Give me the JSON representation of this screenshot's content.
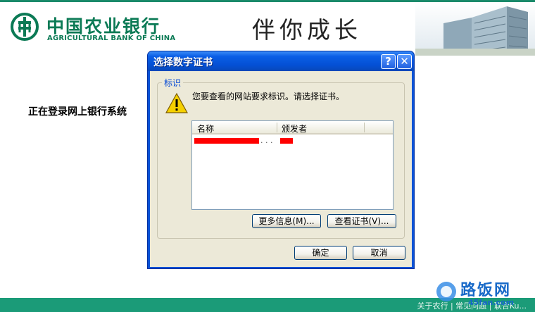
{
  "header": {
    "bank_name_cn": "中国农业银行",
    "bank_name_en": "AGRICULTURAL BANK OF CHINA",
    "slogan": "伴你成长"
  },
  "main": {
    "login_status": "正在登录网上银行系统"
  },
  "dialog": {
    "title": "选择数字证书",
    "help_button": "?",
    "close_button": "✕",
    "group_label": "标识",
    "message": "您要查看的网站要求标识。请选择证书。",
    "columns": [
      "名称",
      "颁发者"
    ],
    "rows": [
      {
        "name_truncation": ". . ."
      }
    ],
    "more_info_button": "更多信息(M)...",
    "view_cert_button": "查看证书(V)...",
    "ok_button": "确定",
    "cancel_button": "取消"
  },
  "footer": {
    "links": "关于农行 | 常见问题 | 联合Ku...",
    "watermark_text": "路饭网",
    "watermark_url": "45fan.com"
  }
}
